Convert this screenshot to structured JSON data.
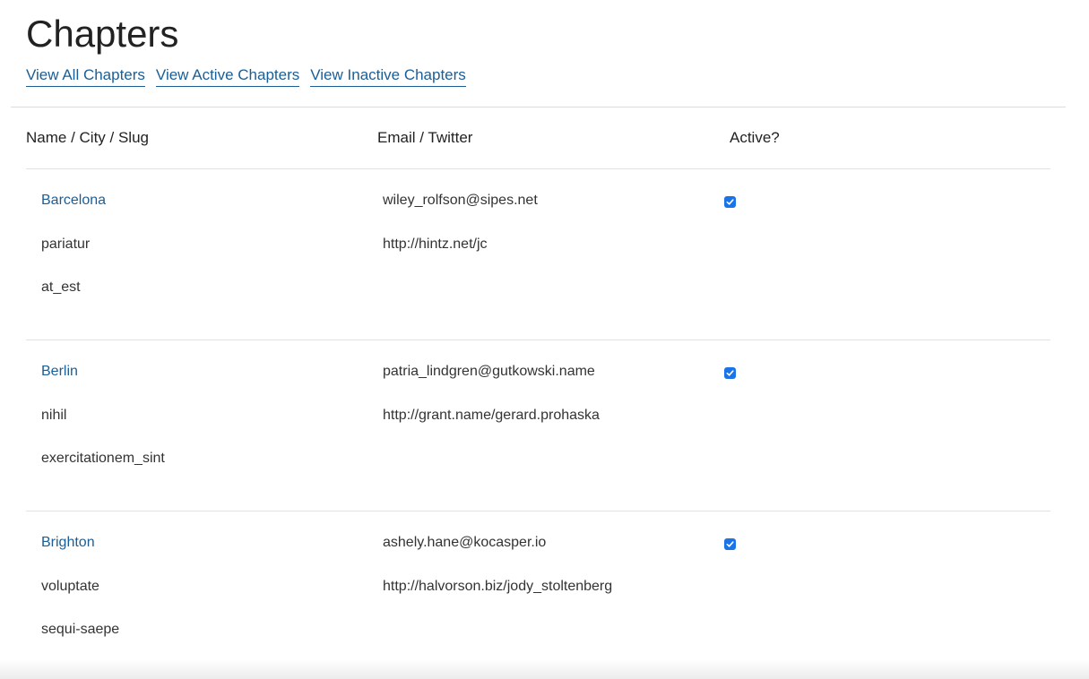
{
  "page": {
    "title": "Chapters"
  },
  "filters": [
    {
      "label": "View All Chapters"
    },
    {
      "label": "View Active Chapters"
    },
    {
      "label": "View Inactive Chapters"
    }
  ],
  "table": {
    "headers": [
      "Name / City / Slug",
      "Email / Twitter",
      "Active?"
    ],
    "rows": [
      {
        "name": "Barcelona",
        "city": "pariatur",
        "slug": "at_est",
        "email": "wiley_rolfson@sipes.net",
        "twitter": "http://hintz.net/jc",
        "active": true
      },
      {
        "name": "Berlin",
        "city": "nihil",
        "slug": "exercitationem_sint",
        "email": "patria_lindgren@gutkowski.name",
        "twitter": "http://grant.name/gerard.prohaska",
        "active": true
      },
      {
        "name": "Brighton",
        "city": "voluptate",
        "slug": "sequi-saepe",
        "email": "ashely.hane@kocasper.io",
        "twitter": "http://halvorson.biz/jody_stoltenberg",
        "active": true
      }
    ]
  },
  "colors": {
    "link": "#1b5e96",
    "checkbox": "#1a73e8",
    "rule": "#e2e2e2"
  },
  "icons": {
    "checkbox": "check-icon"
  }
}
